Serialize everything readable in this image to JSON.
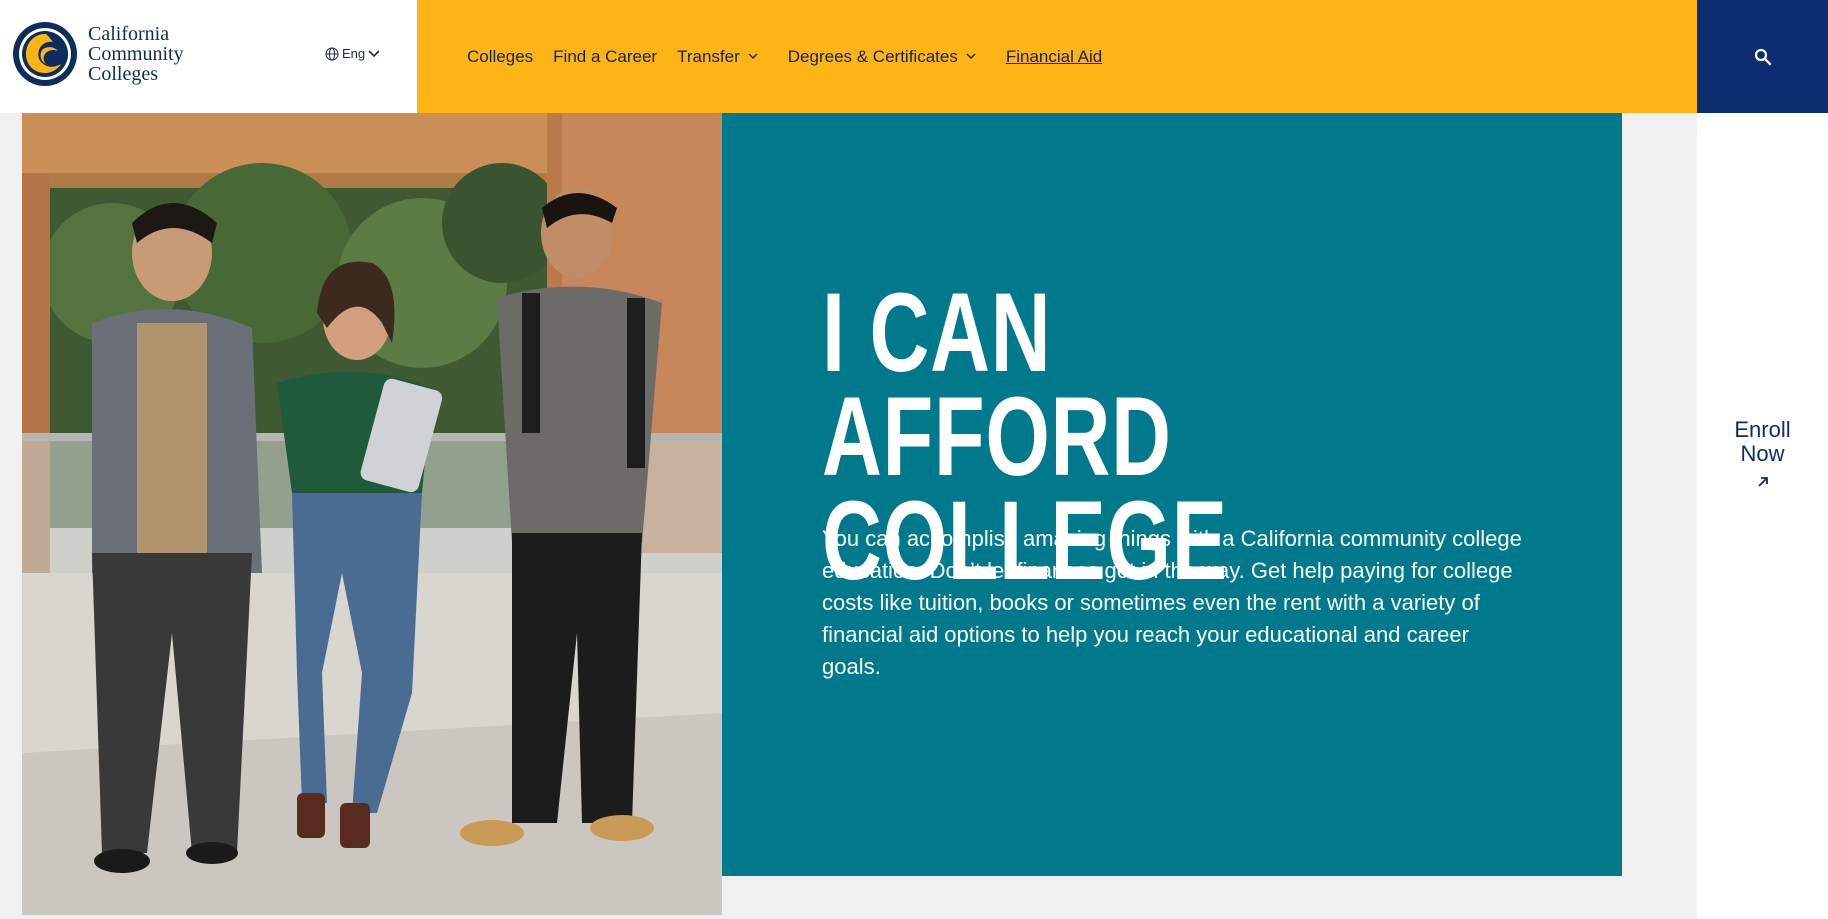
{
  "brand": {
    "logo_lines": [
      "California",
      "Community",
      "Colleges"
    ],
    "language": "Eng"
  },
  "nav": {
    "items": [
      {
        "label": "Colleges"
      },
      {
        "label": "Find a Career"
      },
      {
        "label": "Transfer"
      },
      {
        "label": "Degrees & Certificates"
      },
      {
        "label": "Financial Aid"
      }
    ],
    "search_icon": "search-icon"
  },
  "hero": {
    "title": "I CAN AFFORD COLLEGE",
    "body": "You can accomplish amazing things with a California community college education. Don’t let finances get in the way. Get help paying for college costs like tuition, books or sometimes even the rent with a variety of financial aid options to help you reach your educational and career goals."
  },
  "rail": {
    "enroll_label": "Enroll Now"
  },
  "colors": {
    "nav_bg": "#fdb515",
    "search_bg": "#0b2d6f",
    "hero_panel": "#00798c",
    "brand_navy": "#0d2d5c"
  }
}
